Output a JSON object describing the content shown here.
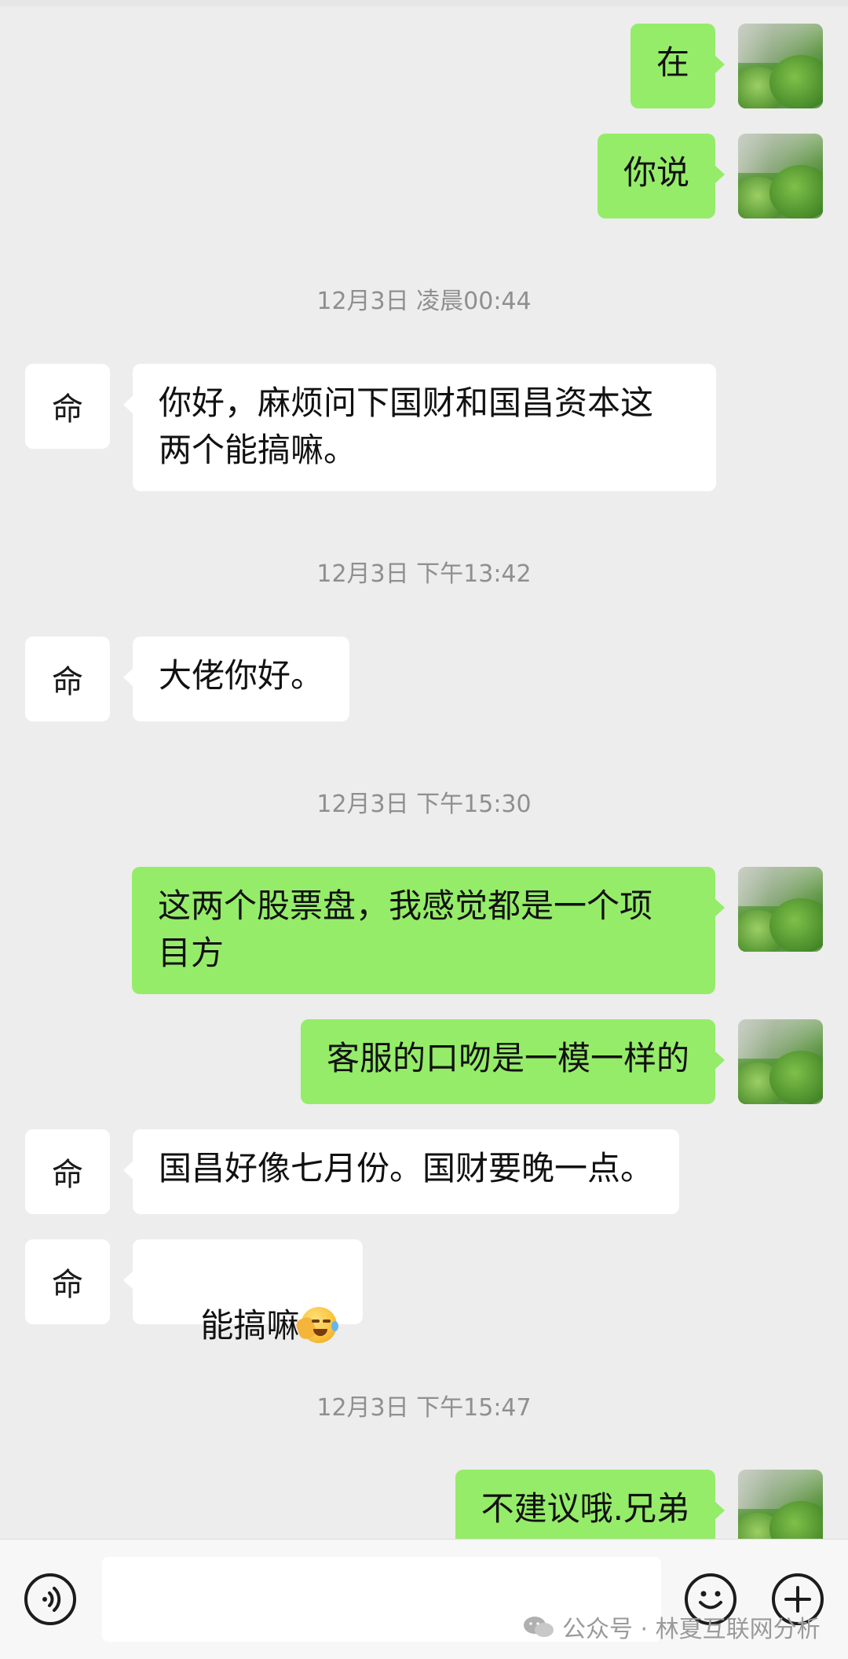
{
  "messages": [
    {
      "id": "m1",
      "sender": "self",
      "text": "在"
    },
    {
      "id": "m2",
      "sender": "self",
      "text": "你说"
    },
    {
      "id": "t1",
      "type": "timestamp",
      "text": "12月3日 凌晨00:44"
    },
    {
      "id": "m3",
      "sender": "other",
      "text": "你好，麻烦问下国财和国昌资本这\n两个能搞嘛。"
    },
    {
      "id": "t2",
      "type": "timestamp",
      "text": "12月3日 下午13:42"
    },
    {
      "id": "m4",
      "sender": "other",
      "text": "大佬你好。"
    },
    {
      "id": "t3",
      "type": "timestamp",
      "text": "12月3日 下午15:30"
    },
    {
      "id": "m5",
      "sender": "self",
      "text": "这两个股票盘，我感觉都是一个项\n目方"
    },
    {
      "id": "m6",
      "sender": "self",
      "text": "客服的口吻是一模一样的"
    },
    {
      "id": "m7",
      "sender": "other",
      "text": "国昌好像七月份。国财要晚一点。"
    },
    {
      "id": "m8",
      "sender": "other",
      "text": "能搞嘛",
      "emoji": "face-holding-back-tears-emoji"
    },
    {
      "id": "t4",
      "type": "timestamp",
      "text": "12月3日 下午15:47"
    },
    {
      "id": "m9",
      "sender": "self",
      "text": "不建议哦.兄弟"
    }
  ],
  "contact": {
    "avatar_glyph": "命"
  },
  "input_bar": {
    "text_value": "",
    "voice_icon": "voice-icon",
    "emoji_icon": "emoji-icon",
    "plus_icon": "plus-icon"
  },
  "watermark": {
    "text": "公众号 · 林夏互联网分析"
  },
  "colors": {
    "background": "#ededed",
    "self_bubble": "#95ec69",
    "other_bubble": "#ffffff",
    "timestamp": "#8f8f8f"
  }
}
